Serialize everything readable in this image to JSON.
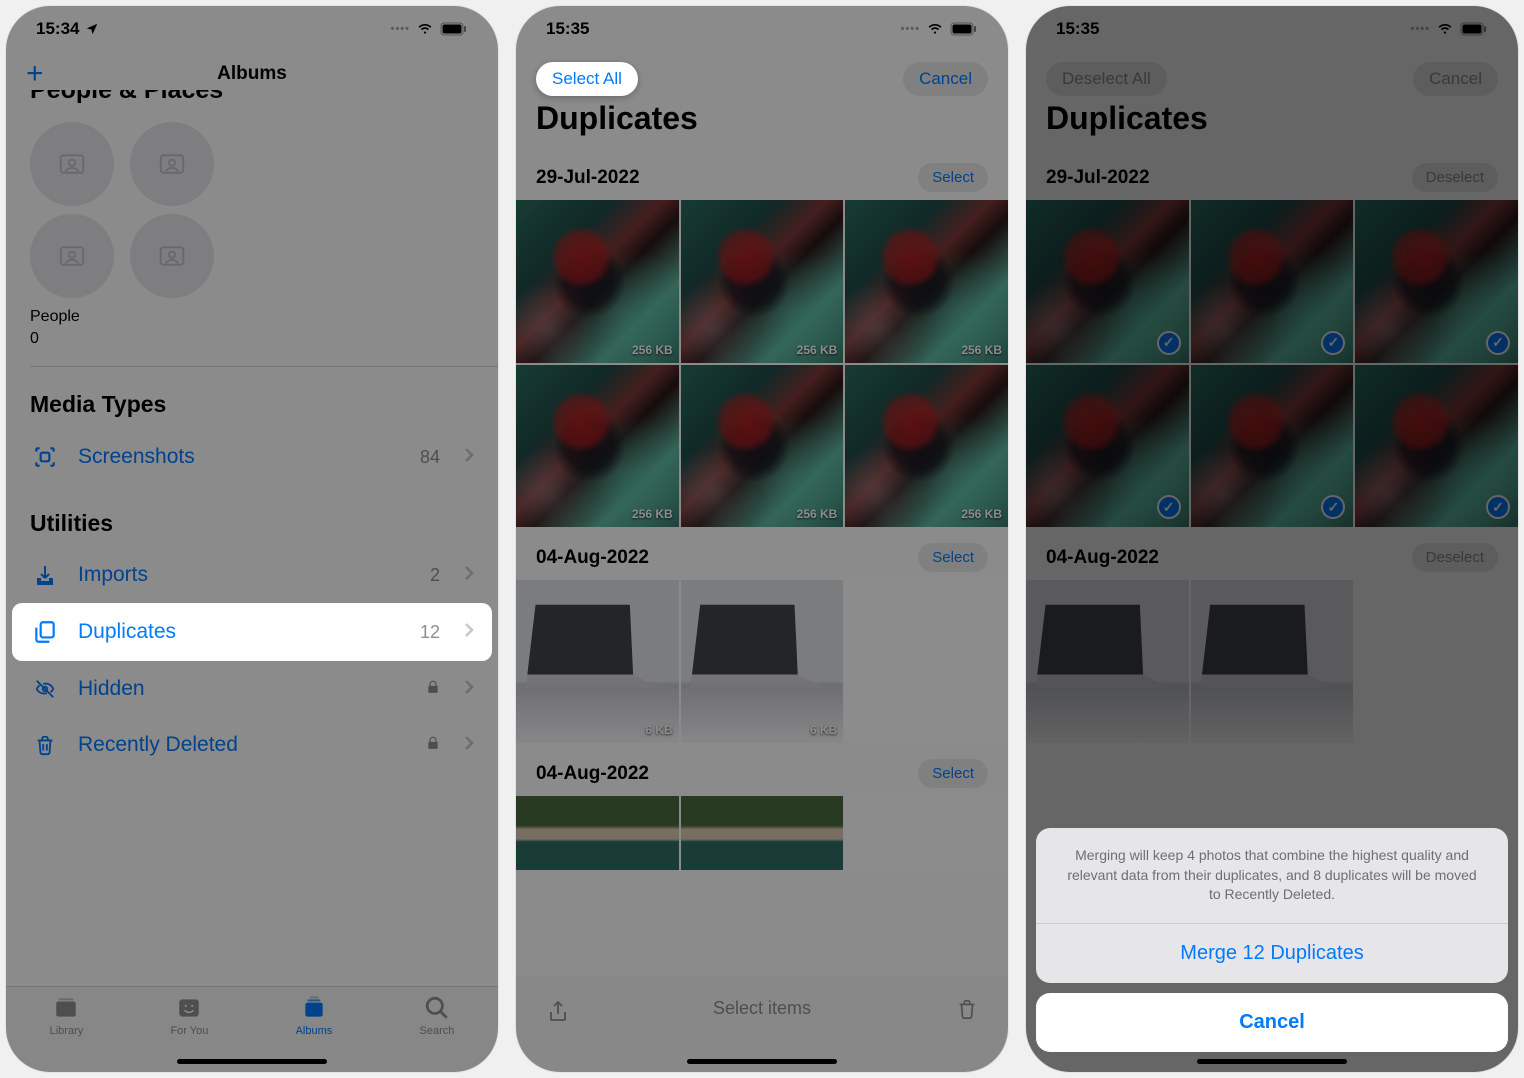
{
  "screen1": {
    "status_time": "15:34",
    "nav_title": "Albums",
    "section_peopleplaces": "People & Places",
    "people_label": "People",
    "people_count": "0",
    "media_types_title": "Media Types",
    "screenshots_label": "Screenshots",
    "screenshots_count": "84",
    "utilities_title": "Utilities",
    "imports_label": "Imports",
    "imports_count": "2",
    "duplicates_label": "Duplicates",
    "duplicates_count": "12",
    "hidden_label": "Hidden",
    "recently_deleted_label": "Recently Deleted",
    "tabs": {
      "library": "Library",
      "for_you": "For You",
      "albums": "Albums",
      "search": "Search"
    }
  },
  "screen2": {
    "status_time": "15:35",
    "select_all": "Select All",
    "cancel": "Cancel",
    "title": "Duplicates",
    "groups": [
      {
        "date": "29-Jul-2022",
        "select": "Select",
        "sizes": [
          "256 KB",
          "256 KB",
          "256 KB",
          "256 KB",
          "256 KB",
          "256 KB"
        ]
      },
      {
        "date": "04-Aug-2022",
        "select": "Select",
        "sizes": [
          "6 KB",
          "6 KB"
        ]
      },
      {
        "date": "04-Aug-2022",
        "select": "Select",
        "sizes": [
          "",
          ""
        ]
      }
    ],
    "toolbar_hint": "Select items"
  },
  "screen3": {
    "status_time": "15:35",
    "deselect_all": "Deselect All",
    "cancel": "Cancel",
    "title": "Duplicates",
    "groups": [
      {
        "date": "29-Jul-2022",
        "select": "Deselect"
      },
      {
        "date": "04-Aug-2022",
        "select": "Deselect"
      }
    ],
    "sheet_message": "Merging will keep 4 photos that combine the highest quality and relevant data from their duplicates, and 8 duplicates will be moved to Recently Deleted.",
    "sheet_merge": "Merge 12 Duplicates",
    "sheet_cancel": "Cancel"
  }
}
